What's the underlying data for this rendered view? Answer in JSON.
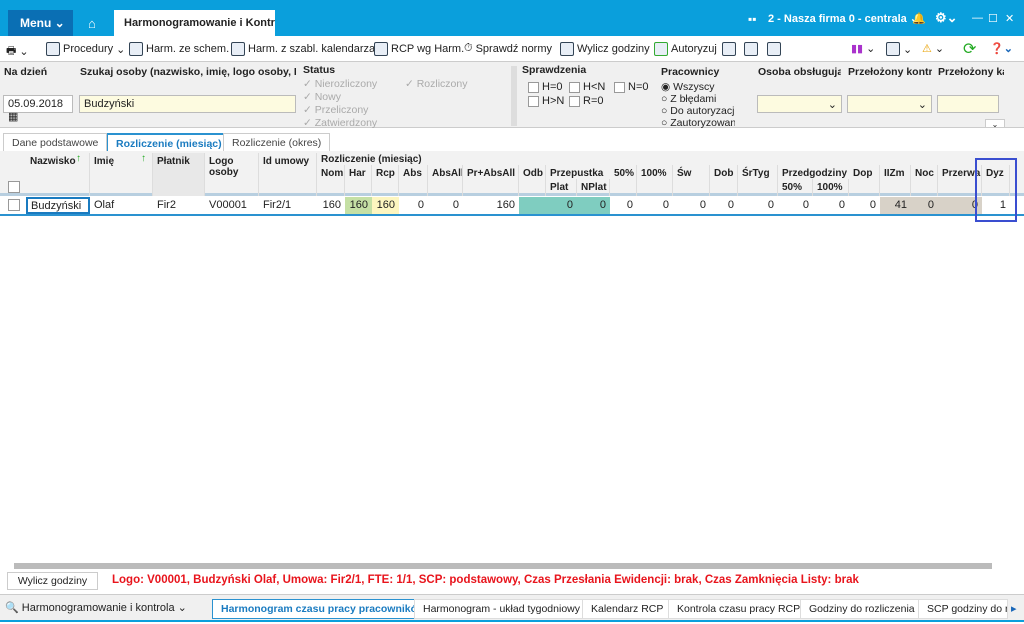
{
  "titlebar": {
    "menu": "Menu",
    "app_tab": "Harmonogramowanie i Kontrola",
    "company": "2 - Nasza firma 0 - centrala"
  },
  "toolbar": {
    "procedury": "Procedury",
    "harm_schem": "Harm. ze schem.",
    "harm_szabl": "Harm. z szabl. kalendarza",
    "rcp": "RCP wg Harm.",
    "sprawdz": "Sprawdź normy",
    "wylicz": "Wylicz godziny",
    "autoryzuj": "Autoryzuj"
  },
  "filters": {
    "na_dzien_label": "Na dzień",
    "date": "05.09.2018",
    "search_label": "Szukaj osoby (nazwisko, imię, logo osoby, PESEL",
    "search_value": "Budzyński",
    "status_label": "Status",
    "status": [
      "Nierozliczony",
      "Nowy",
      "Przeliczony",
      "Zatwierdzony",
      "Rozliczony"
    ],
    "sprawdzenia_label": "Sprawdzenia",
    "checks": [
      "H=0",
      "H<N",
      "N=0",
      "H>N",
      "R=0"
    ],
    "pracownicy_label": "Pracownicy",
    "pracownicy": [
      "Wszyscy",
      "Z błędami",
      "Do autoryzacji",
      "Zautoryzowani"
    ],
    "osoba_label": "Osoba obsługująca",
    "przel_kon_label": "Przełożony kontrolujący",
    "przel_kad_label": "Przełożony kadrowy"
  },
  "tabs": [
    "Dane podstawowe",
    "Rozliczenie (miesiąc)",
    "Rozliczenie (okres)"
  ],
  "grid": {
    "group_label": "Rozliczenie (miesiąc)",
    "przepustka": "Przepustka",
    "przedgodziny": "Przedgodziny",
    "columns": [
      "Nazwisko",
      "Imię",
      "Płatnik",
      "Logo osoby",
      "Id umowy",
      "Nom",
      "Har",
      "Rcp",
      "Abs",
      "AbsAll",
      "Pr+AbsAll",
      "Odb",
      "Plat",
      "NPlat",
      "50%",
      "100%",
      "Św",
      "Dob",
      "ŚrTyg",
      "50%",
      "100%",
      "Dop",
      "IIZm",
      "Noc",
      "Przerwa",
      "Dyz"
    ],
    "row": [
      "Budzyński",
      "Olaf",
      "Fir2",
      "V00001",
      "Fir2/1",
      "160",
      "160",
      "160",
      "0",
      "0",
      "160",
      "",
      "0",
      "0",
      "0",
      "0",
      "0",
      "0",
      "0",
      "0",
      "0",
      "0",
      "41",
      "0",
      "0",
      "1"
    ]
  },
  "status_bar": {
    "button": "Wylicz godziny",
    "message": "Logo: V00001, Budzyński Olaf, Umowa: Fir2/1, FTE: 1/1, SCP: podstawowy, Czas Przesłania Ewidencji: brak, Czas Zamknięcia Listy: brak"
  },
  "bottom": {
    "module": "Harmonogramowanie i kontrola",
    "tabs": [
      "Harmonogram czasu pracy pracowników",
      "Harmonogram - układ tygodniowy",
      "Kalendarz RCP",
      "Kontrola czasu pracy RCP",
      "Godziny do rozliczenia",
      "SCP godziny do rozliczenia"
    ]
  },
  "colors": {
    "accent": "#0a9fdc",
    "har": "#c5e0a5",
    "rcp": "#fdf6c0",
    "przepustka": "#7fcdc0",
    "iizm": "#d8d2c8",
    "error": "#e8141c"
  }
}
